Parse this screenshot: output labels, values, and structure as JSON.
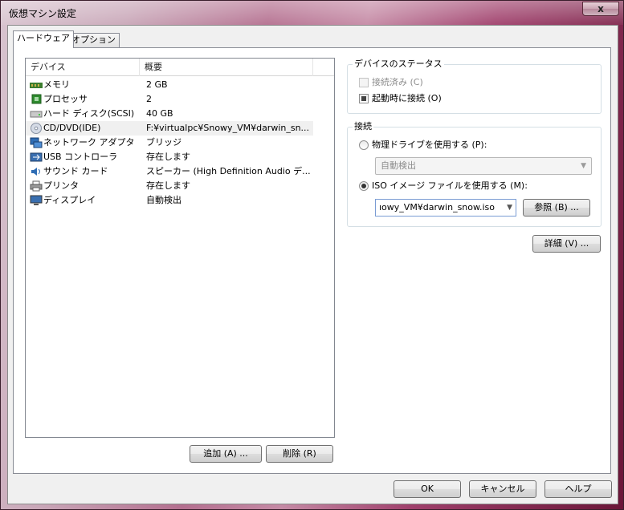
{
  "window": {
    "title": "仮想マシン設定",
    "close_label": "x"
  },
  "tabs": [
    {
      "label": "ハードウェア"
    },
    {
      "label": "オプション"
    }
  ],
  "device_list": {
    "columns": [
      "デバイス",
      "概要"
    ],
    "rows": [
      {
        "device": "メモリ",
        "summary": "2 GB",
        "icon": "memory-icon"
      },
      {
        "device": "プロセッサ",
        "summary": "2",
        "icon": "processor-icon"
      },
      {
        "device": "ハード ディスク(SCSI)",
        "summary": "40 GB",
        "icon": "hard-disk-icon"
      },
      {
        "device": "CD/DVD(IDE)",
        "summary": "F:¥virtualpc¥Snowy_VM¥darwin_sn...",
        "icon": "cd-dvd-icon"
      },
      {
        "device": "ネットワーク アダプタ",
        "summary": "ブリッジ",
        "icon": "network-adapter-icon"
      },
      {
        "device": "USB コントローラ",
        "summary": "存在します",
        "icon": "usb-icon"
      },
      {
        "device": "サウンド カード",
        "summary": "スピーカー (High Definition Audio デ...",
        "icon": "sound-card-icon"
      },
      {
        "device": "プリンタ",
        "summary": "存在します",
        "icon": "printer-icon"
      },
      {
        "device": "ディスプレイ",
        "summary": "自動検出",
        "icon": "display-icon"
      }
    ],
    "selected_index": 3
  },
  "list_buttons": {
    "add": "追加 (A) ...",
    "remove": "削除 (R)"
  },
  "device_status": {
    "title": "デバイスのステータス",
    "connected_label": "接続済み (C)",
    "connected": false,
    "connect_at_power_on_label": "起動時に接続 (O)",
    "connect_at_power_on": true
  },
  "connection": {
    "title": "接続",
    "physical_drive_label": "物理ドライブを使用する (P):",
    "physical_drive_value": "自動検出",
    "iso_label": "ISO イメージ ファイルを使用する (M):",
    "iso_value": "ıowy_VM¥darwin_snow.iso",
    "browse_label": "参照 (B) ...",
    "selected": "iso"
  },
  "advanced_label": "詳細 (V) ...",
  "footer": {
    "ok": "OK",
    "cancel": "キャンセル",
    "help": "ヘルプ"
  }
}
